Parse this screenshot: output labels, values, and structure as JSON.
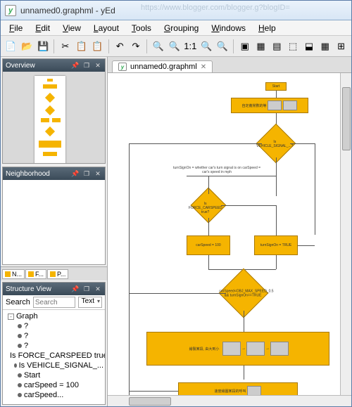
{
  "app_icon_letter": "y",
  "title": "unnamed0.graphml - yEd",
  "faint_browser_url": "https://www.blogger.com/blogger.g?blogID=",
  "menubar": [
    "File",
    "Edit",
    "View",
    "Layout",
    "Tools",
    "Grouping",
    "Windows",
    "Help"
  ],
  "toolbar_icons": [
    {
      "name": "new-doc",
      "glyph": "📄"
    },
    {
      "name": "open-doc",
      "glyph": "📂"
    },
    {
      "name": "save-doc",
      "glyph": "💾"
    },
    {
      "name": "sep"
    },
    {
      "name": "cut",
      "glyph": "✂"
    },
    {
      "name": "copy",
      "glyph": "📋"
    },
    {
      "name": "paste",
      "glyph": "📋"
    },
    {
      "name": "sep"
    },
    {
      "name": "undo",
      "glyph": "↶"
    },
    {
      "name": "redo",
      "glyph": "↷"
    },
    {
      "name": "sep"
    },
    {
      "name": "zoom-in",
      "glyph": "🔍"
    },
    {
      "name": "zoom-out",
      "glyph": "🔍"
    },
    {
      "name": "zoom-1-1",
      "glyph": "1:1"
    },
    {
      "name": "zoom-sel",
      "glyph": "🔍"
    },
    {
      "name": "zoom-fit",
      "glyph": "🔍"
    },
    {
      "name": "sep"
    },
    {
      "name": "fit-content",
      "glyph": "▣"
    },
    {
      "name": "select-mode",
      "glyph": "▦"
    },
    {
      "name": "edit-mode",
      "glyph": "▤"
    },
    {
      "name": "hierarchy",
      "glyph": "⬚"
    },
    {
      "name": "tree-layout",
      "glyph": "⬓"
    },
    {
      "name": "grid",
      "glyph": "▦"
    },
    {
      "name": "grid2",
      "glyph": "⊞"
    }
  ],
  "panels": {
    "overview": {
      "title": "Overview"
    },
    "neighborhood": {
      "title": "Neighborhood"
    },
    "structure": {
      "title": "Structure View",
      "search_label": "Search",
      "text_filter_label": "Text",
      "tree": [
        {
          "level": 0,
          "label": "Graph",
          "toggle": "-"
        },
        {
          "level": 1,
          "label": "?",
          "dot": true
        },
        {
          "level": 1,
          "label": "?",
          "dot": true
        },
        {
          "level": 1,
          "label": "?",
          "dot": true
        },
        {
          "level": 1,
          "label": "Is FORCE_CARSPEED true?",
          "dot": true
        },
        {
          "level": 1,
          "label": "Is VEHICLE_SIGNAL_...",
          "dot": true
        },
        {
          "level": 1,
          "label": "Start",
          "dot": true
        },
        {
          "level": 1,
          "label": "carSpeed = 100",
          "dot": true
        },
        {
          "level": 1,
          "label": "carSpeed...",
          "dot": true
        }
      ]
    },
    "mini_tabs": [
      {
        "label": "N..."
      },
      {
        "label": "F..."
      },
      {
        "label": "P..."
      }
    ]
  },
  "document": {
    "tab_label": "unnamed0.graphml",
    "nodes": {
      "start": "Start",
      "render_zoom": "自定義常數的等",
      "vehicle_signal": "Is VEHICLE_SIGNAL_...?",
      "turn_signal_label": "turnSignOn = whether car's turn signal is on\ncarSpeed = car's speed in mph",
      "force_carspeed": "Is FORCE_CARSPEED true?",
      "speed100": "carSpeed = 100",
      "turnsign_true": "turnSignOn = TRUE",
      "max_speed": "carSpeed<OBJ_MAX_SPEED_0.5 && turnSignOn==TRUE",
      "render_scale": "繪製某段, 由大到小",
      "asset_footer": "速度繪圖某段的呼叫"
    }
  }
}
